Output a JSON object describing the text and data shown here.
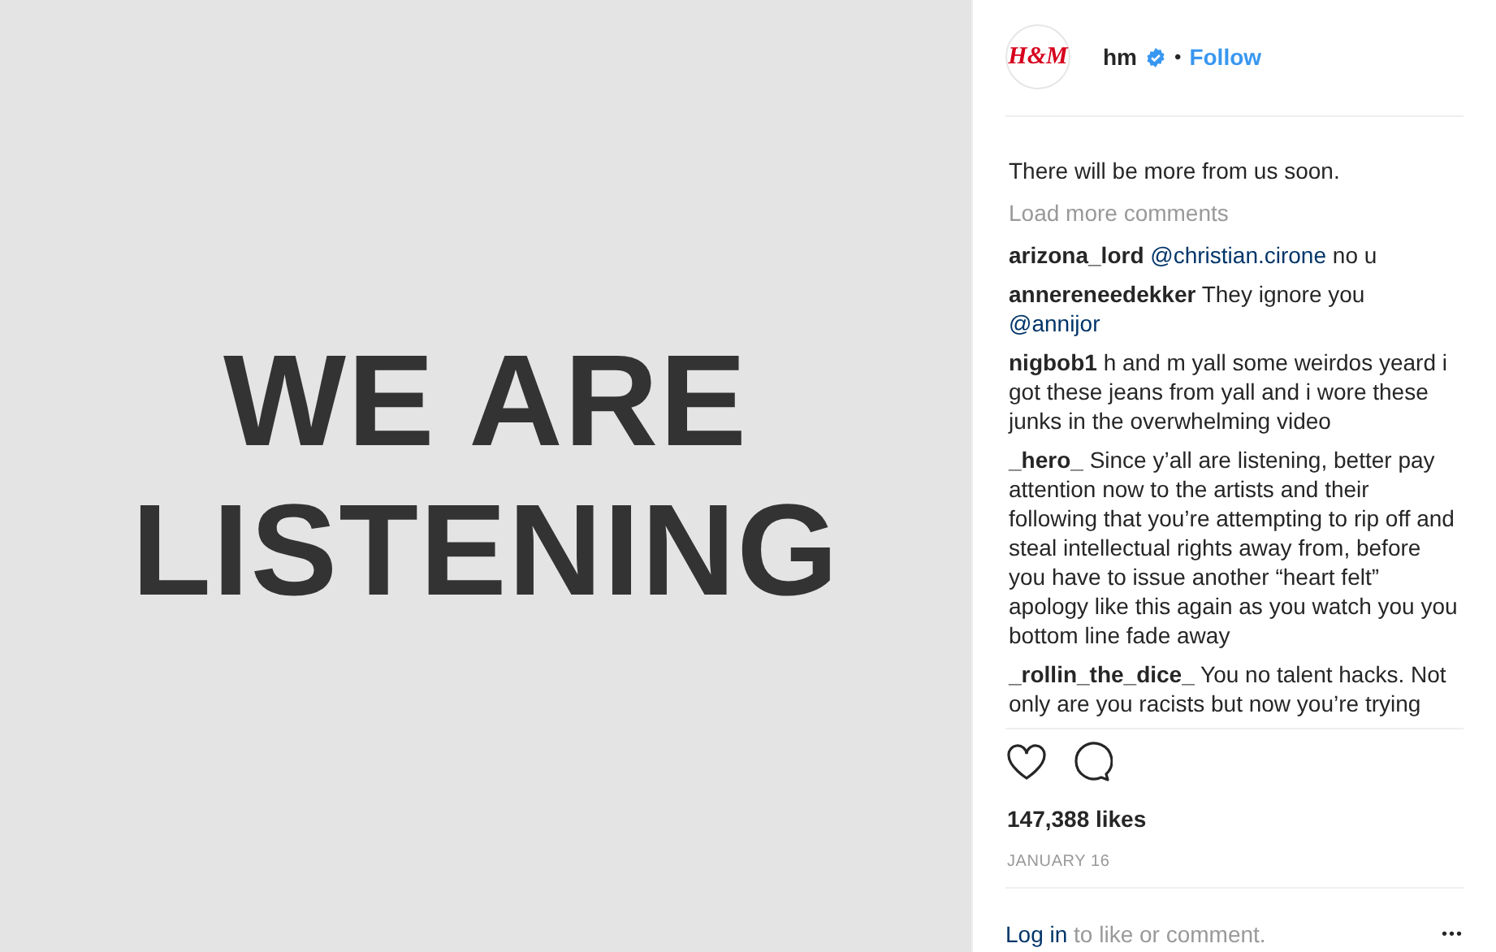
{
  "post_image": {
    "headline_lines": [
      "WE ARE",
      "LISTENING"
    ]
  },
  "header": {
    "avatar_text": "H&M",
    "username": "hm",
    "verified": true,
    "separator": "•",
    "follow": "Follow"
  },
  "caption_end": "There will be more from us soon.",
  "load_more": "Load more comments",
  "comments": [
    {
      "user": "arizona_lord",
      "parts": [
        {
          "kind": "mention",
          "text": "@christian.cirone"
        },
        {
          "kind": "text",
          "text": " no u"
        }
      ]
    },
    {
      "user": "annereneedekker",
      "parts": [
        {
          "kind": "text",
          "text": "They ignore you "
        },
        {
          "kind": "mention",
          "text": "@annijor"
        }
      ]
    },
    {
      "user": "nigbob1",
      "parts": [
        {
          "kind": "text",
          "text": "h and m yall some weirdos yeard i got these jeans from yall and i wore these junks in the overwhelming video"
        }
      ]
    },
    {
      "user": "_hero_",
      "parts": [
        {
          "kind": "text",
          "text": "Since y’all are listening, better pay attention now to the artists and their following that you’re attempting to rip off and steal intellectual rights away from, before you have to issue another “heart felt” apology like this again as you watch you you bottom line fade away"
        }
      ]
    },
    {
      "user": "_rollin_the_dice_",
      "parts": [
        {
          "kind": "text",
          "text": "You no talent hacks. Not only are you racists but now you’re trying"
        }
      ]
    }
  ],
  "likes": "147,388 likes",
  "date": "JANUARY 16",
  "footer": {
    "login_link": "Log in",
    "login_rest": " to like or comment.",
    "more": "•••"
  }
}
